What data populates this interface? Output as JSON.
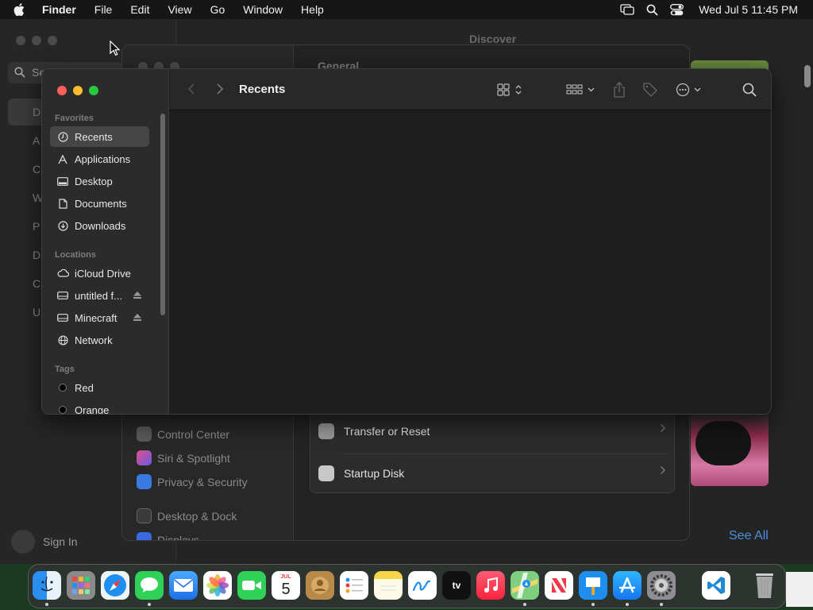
{
  "menubar": {
    "app": "Finder",
    "items": [
      "File",
      "Edit",
      "View",
      "Go",
      "Window",
      "Help"
    ],
    "clock": "Wed Jul 5  11:45 PM"
  },
  "background_app": {
    "search_placeholder": "Se",
    "sidebar_letters": [
      "D",
      "A",
      "C",
      "W",
      "P",
      "D",
      "C",
      "U"
    ],
    "title": "Discover",
    "signin": "Sign In",
    "see_all": "See All"
  },
  "settings": {
    "section_title": "General",
    "sidebar": [
      {
        "label": "Control Center",
        "color": "#5a5a5a"
      },
      {
        "label": "Siri & Spotlight",
        "color": "#8a4fc4"
      },
      {
        "label": "Privacy & Security",
        "color": "#3a7ae0"
      },
      {
        "label": "Desktop & Dock",
        "color": "#3a3a3a"
      },
      {
        "label": "Displays",
        "color": "#3a6ae0"
      }
    ],
    "rows": [
      "Transfer or Reset",
      "Startup Disk"
    ]
  },
  "finder": {
    "title": "Recents",
    "favorites_label": "Favorites",
    "favorites": [
      {
        "label": "Recents",
        "icon": "clock-icon"
      },
      {
        "label": "Applications",
        "icon": "applications-icon"
      },
      {
        "label": "Desktop",
        "icon": "desktop-icon"
      },
      {
        "label": "Documents",
        "icon": "document-icon"
      },
      {
        "label": "Downloads",
        "icon": "download-icon"
      }
    ],
    "locations_label": "Locations",
    "locations": [
      {
        "label": "iCloud Drive",
        "icon": "cloud-icon"
      },
      {
        "label": "untitled f...",
        "icon": "drive-icon",
        "eject": true
      },
      {
        "label": "Minecraft",
        "icon": "drive-icon",
        "eject": true
      },
      {
        "label": "Network",
        "icon": "globe-icon"
      }
    ],
    "tags_label": "Tags",
    "tags": [
      "Red",
      "Orange"
    ]
  },
  "dock": {
    "apps": [
      "Finder",
      "Launchpad",
      "Safari",
      "Messages",
      "Mail",
      "Photos",
      "FaceTime",
      "Calendar",
      "Contacts",
      "Reminders",
      "Notes",
      "Freeform",
      "Apple TV",
      "Music",
      "Maps",
      "News",
      "Keynote",
      "App Store",
      "System Settings",
      "Visual Studio Code",
      "Trash"
    ],
    "calendar_month": "JUL",
    "calendar_day": "5",
    "tv_label": "tv"
  },
  "colors": {
    "close": "#fe5f57",
    "minimize": "#febc2e",
    "zoom": "#28c840",
    "accent": "#4a8fe0"
  }
}
